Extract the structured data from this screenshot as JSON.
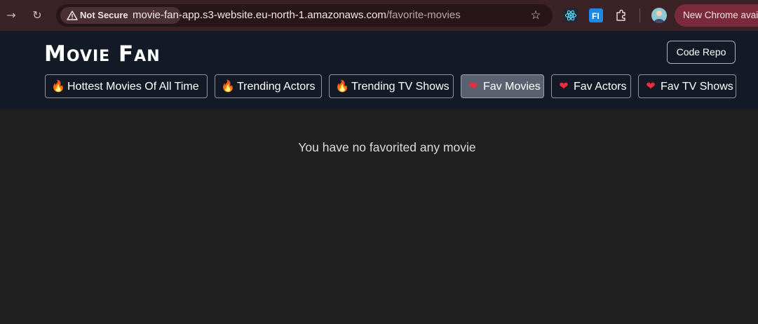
{
  "browser": {
    "back_icon": "arrow-right-icon",
    "reload_icon": "reload-icon",
    "security_label": "Not Secure",
    "url_host": "movie-fan-app.s3-website.eu-north-1.amazonaws.com",
    "url_path": "/favorite-movies",
    "bookmark_icon": "star-icon",
    "extensions": [
      "react-devtools-icon",
      "fi-extension-icon",
      "puzzle-icon"
    ],
    "new_chrome_label": "New Chrome available"
  },
  "app": {
    "logo": "Movie Fan",
    "code_repo_label": "Code Repo",
    "tabs": [
      {
        "icon": "🔥",
        "label": "Hottest Movies Of All Time",
        "active": false
      },
      {
        "icon": "🔥",
        "label": "Trending Actors",
        "active": false
      },
      {
        "icon": "🔥",
        "label": "Trending TV Shows",
        "active": false
      },
      {
        "icon": "❤",
        "label": "Fav Movies",
        "active": true
      },
      {
        "icon": "❤",
        "label": "Fav Actors",
        "active": false
      },
      {
        "icon": "❤",
        "label": "Fav TV Shows",
        "active": false
      }
    ],
    "empty_message": "You have no favorited any movie"
  },
  "colors": {
    "header_bg": "#141a25",
    "page_bg": "#202020",
    "active_tab_bg": "#5a6270",
    "chrome_bg": "#3b2226"
  }
}
